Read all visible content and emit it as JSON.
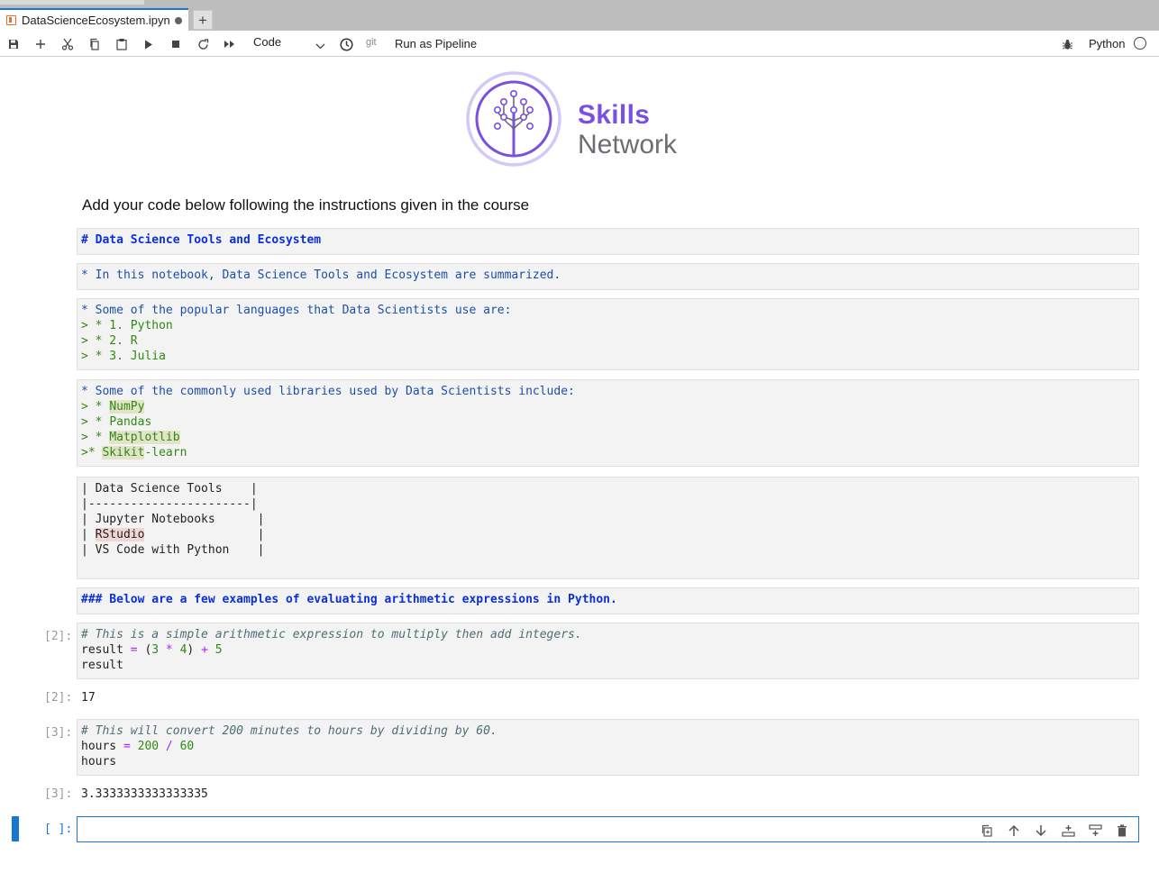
{
  "tab": {
    "filename": "DataScienceEcosystem.ipyn"
  },
  "toolbar": {
    "cell_type": "Code",
    "git_label": "git",
    "pipeline_label": "Run as Pipeline",
    "kernel_name": "Python"
  },
  "logo": {
    "line1": "Skills",
    "line2": "Network"
  },
  "intro": "Add your code below following the instructions given in the course",
  "cells": {
    "title": "# Data Science Tools and Ecosystem",
    "summary": "* In this notebook, Data Science Tools and Ecosystem are summarized.",
    "languages": {
      "header": "* Some of the popular languages that Data Scientists use are:",
      "items": [
        "> * 1. Python",
        "> * 2. R",
        "> * 3. Julia"
      ]
    },
    "libraries": {
      "header": "* Some of the commonly used libraries used by Data Scientists include:",
      "prefix": "> * ",
      "items": [
        "NumPy",
        "Pandas",
        "Matplotlib"
      ],
      "last_prefix": ">* ",
      "last_hl": "Skikit",
      "last_rest": "-learn"
    },
    "table": {
      "header": "| Data Science Tools    |",
      "separator": "|-----------------------|",
      "row1": "| Jupyter Notebooks      |",
      "row2_prefix": "| ",
      "row2_hl": "RStudio",
      "row2_suffix": "                |",
      "row3": "| VS Code with Python    |"
    },
    "examples_heading": "### Below are a few examples of evaluating arithmetic expressions in Python."
  },
  "code1": {
    "prompt": "[2]:",
    "comment": "# This is a simple arithmetic expression to multiply then add integers.",
    "t1": "result ",
    "t2": "=",
    "t3": " (",
    "t4": "3",
    "t5": " * ",
    "t6": "4",
    "t7": ") ",
    "t8": "+",
    "t9": " ",
    "t10": "5",
    "line3": "result",
    "out_prompt": "[2]:",
    "output": "17"
  },
  "code2": {
    "prompt": "[3]:",
    "comment": "# This will convert 200 minutes to hours by dividing by 60.",
    "t1": "hours ",
    "t2": "=",
    "t3": " ",
    "t4": "200",
    "t5": " / ",
    "t6": "60",
    "line3": "hours",
    "out_prompt": "[3]:",
    "output": "3.3333333333333335"
  },
  "empty_cell": {
    "prompt": "[ ]:"
  }
}
